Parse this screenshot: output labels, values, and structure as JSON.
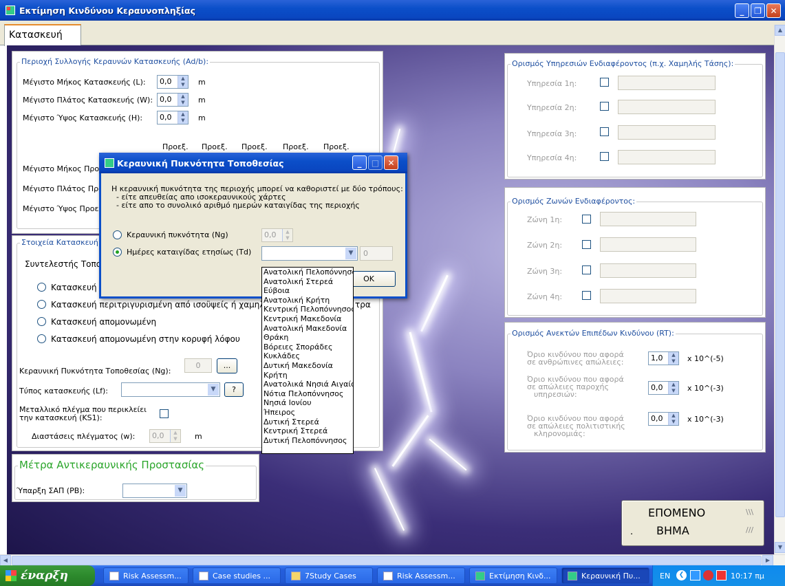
{
  "window": {
    "title": "Εκτίμηση Κινδύνου Κεραυνοπληξίας",
    "tab": "Κατασκευή"
  },
  "ad_group": {
    "title": "Περιοχή Συλλογής Κεραυνών Κατασκευής (Ad/b):",
    "rows": [
      {
        "label": "Μέγιστο Μήκος Κατασκευής (L):",
        "value": "0,0",
        "unit": "m"
      },
      {
        "label": "Μέγιστο Πλάτος Κατασκευής (W):",
        "value": "0,0",
        "unit": "m"
      },
      {
        "label": "Μέγιστο Ύψος Κατασκευής (H):",
        "value": "0,0",
        "unit": "m"
      }
    ],
    "proj_headers": [
      "Προεξ.",
      "Προεξ.",
      "Προεξ.",
      "Προεξ.",
      "Προεξ."
    ],
    "proj_rows": [
      "Μέγιστο Μήκος Προε",
      "Μέγιστο Πλάτος Προ",
      "Μέγιστο Ύψος Προεξ"
    ]
  },
  "struct_group": {
    "title": "Στοιχεία Κατασκευή",
    "coef_label": "Συντελεστής Τοποθ",
    "radios": [
      "Κατασκευή π",
      "Κατασκευή περιτριγυρισμένη από ισοϋψείς ή χαμηλότε",
      "Κατασκευή απομονωμένη",
      "Κατασκευή απομονωμένη στην κορυφή λόφου"
    ],
    "radio_tail": "τρα",
    "ng_label": "Κεραυνική Πυκνότητα Τοποθεσίας (Ng):",
    "ng_value": "0",
    "ng_button": "...",
    "type_label": "Τύπος κατασκευής (Lf):",
    "type_button": "?",
    "mesh_label_1": "Μεταλλικό πλέγμα που περικλείει",
    "mesh_label_2": "την κατασκευή (KS1):",
    "mesh_dim_label": "Διαστάσεις πλέγματος (w):",
    "mesh_value": "0,0",
    "mesh_unit": "m"
  },
  "protection_group": {
    "title": "Μέτρα Αντικεραυνικής Προστασίας",
    "spd_label": "Ύπαρξη ΣΑΠ (PB):"
  },
  "services_group": {
    "title": "Ορισμός Υπηρεσιών Ενδιαφέροντος (π.χ. Χαμηλής Τάσης):",
    "items": [
      "Υπηρεσία 1η:",
      "Υπηρεσία 2η:",
      "Υπηρεσία 3η:",
      "Υπηρεσία 4η:"
    ]
  },
  "zones_group": {
    "title": "Ορισμός Ζωνών Ενδιαφέροντος:",
    "items": [
      "Ζώνη 1η:",
      "Ζώνη 2η:",
      "Ζώνη 3η:",
      "Ζώνη 4η:"
    ]
  },
  "risk_group": {
    "title": "Ορισμός Ανεκτών Επιπέδων Κινδύνου (RT):",
    "rows": [
      {
        "l1": "Όριο κινδύνου που αφορά",
        "l2": "σε ανθρώπινες απώλειες:",
        "l3": "",
        "value": "1,0",
        "exp": "x 10^(-5)"
      },
      {
        "l1": "Όριο κινδύνου που αφορά",
        "l2": "σε απώλειες παροχής",
        "l3": "υπηρεσιών:",
        "value": "0,0",
        "exp": "x 10^(-3)"
      },
      {
        "l1": "Όριο κινδύνου που αφορά",
        "l2": "σε απώλειες πολιτιστικής",
        "l3": "κληρονομιάς:",
        "value": "0,0",
        "exp": "x 10^(-3)"
      }
    ]
  },
  "next_button": {
    "line1": "ΕΠΟΜΕΝΟ",
    "line2": "ΒΗΜΑ",
    "dot": ".",
    "deco1": "\\\\\\",
    "deco2": "///"
  },
  "dialog": {
    "title": "Κεραυνική Πυκνότητα Τοποθεσίας",
    "intro": "Η κεραυνική πυκνότητα της περιοχής μπορεί να καθοριστεί με δύο τρόπους:",
    "bullet1": "- είτε απευθείας απο ισοκεραυνικούς χάρτες",
    "bullet2": "- είτε απο το συνολικό αριθμό ημερών καταιγίδας της περιοχής",
    "radio_ng": "Κεραυνική πυκνότητα (Ng)",
    "ng_value": "0,0",
    "radio_td": "Ημέρες καταιγίδας ετησίως (Td)",
    "td_value": "0",
    "ok": "OK"
  },
  "regions": [
    "Ανατολική Πελοπόννησος",
    "Ανατολική Στερεά",
    "Εύβοια",
    "Ανατολική Κρήτη",
    "Κεντρική Πελοπόννησος",
    "Κεντρική Μακεδονία",
    "Ανατολική Μακεδονία",
    "Θράκη",
    "Βόρειες Σποράδες",
    "Κυκλάδες",
    "Δυτική Μακεδονία",
    "Κρήτη",
    "Ανατολικά Νησιά Αιγαίου",
    "Νότια Πελοπόννησος",
    "Νησιά Ιονίου",
    "Ήπειρος",
    "Δυτική Στερεά",
    "Κεντρική Στερεά",
    "Δυτική Πελοπόννησος"
  ],
  "taskbar": {
    "start": "έναρξη",
    "tasks": [
      "Risk Assessm...",
      "Case studies ...",
      "7Study Cases",
      "Risk Assessm...",
      "Εκτίμηση Κινδ...",
      "Κεραυνική Πυ..."
    ],
    "lang": "EN",
    "clock": "10:17 πμ"
  }
}
